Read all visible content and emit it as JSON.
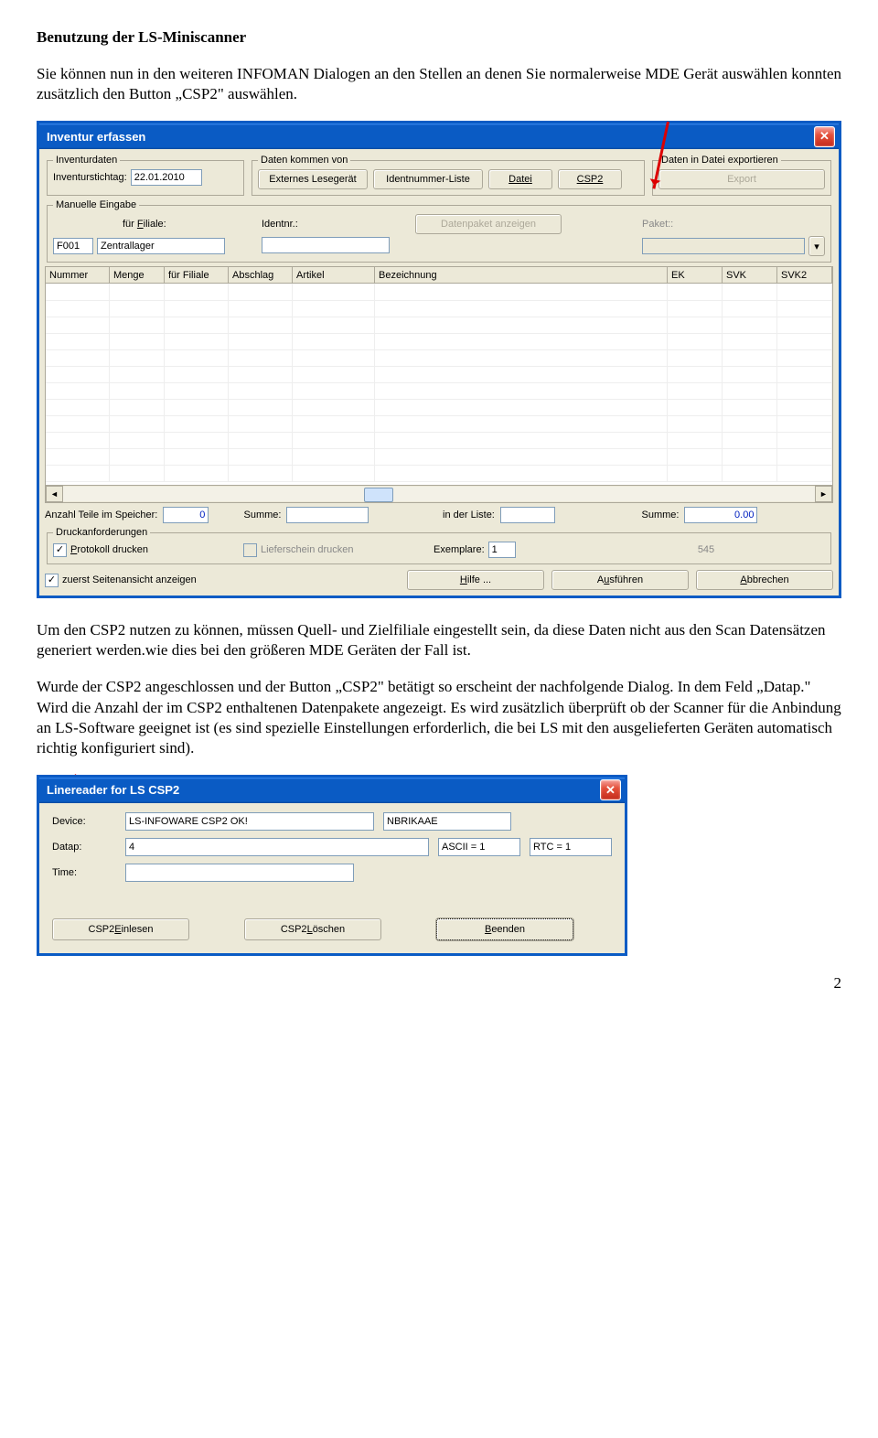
{
  "doc": {
    "heading": "Benutzung der LS-Miniscanner",
    "p1": "Sie können nun in den weiteren INFOMAN Dialogen an den Stellen an denen Sie normalerweise MDE Gerät auswählen konnten zusätzlich den Button „CSP2\" auswählen.",
    "p2": "Um den CSP2 nutzen zu können, müssen Quell- und Zielfiliale eingestellt sein, da diese Daten nicht aus den Scan Datensätzen generiert werden.wie dies bei den größeren MDE Geräten der Fall ist.",
    "p3": "Wurde der CSP2 angeschlossen und der Button „CSP2\" betätigt so erscheint der nachfolgende Dialog. In dem Feld „Datap.\" Wird die Anzahl der im CSP2 enthaltenen Datenpakete angezeigt. Es wird zusätzlich überprüft ob der Scanner für die Anbindung an LS-Software geeignet ist (es sind spezielle Einstellungen erforderlich, die bei LS mit den ausgelieferten Geräten automatisch richtig konfiguriert sind).",
    "pagenum": "2"
  },
  "win1": {
    "title": "Inventur erfassen",
    "groups": {
      "inv": "Inventurdaten",
      "daten": "Daten kommen von",
      "export": "Daten in Datei exportieren",
      "manuelle": "Manuelle Eingabe",
      "druck": "Druckanforderungen"
    },
    "labels": {
      "stichtag": "Inventurstichtag:",
      "filiale_u": "für Filiale:",
      "identnr": "Identnr.:",
      "anzahl": "Anzahl Teile im Speicher:",
      "summe": "Summe:",
      "inliste": "in der Liste:",
      "exemplare": "Exemplare:",
      "paket": "Paket::"
    },
    "values": {
      "stichtag": "22.01.2010",
      "f001": "F001",
      "zentrallager": "Zentrallager",
      "anzahl": "0",
      "summe1": "",
      "inliste": "",
      "summe2": "0.00",
      "exemplare": "1",
      "num545": "545"
    },
    "buttons": {
      "externes": "Externes Lesegerät",
      "identliste": "Identnummer-Liste",
      "datei": "Datei",
      "csp2": "CSP2",
      "export": "Export",
      "datenpaket": "Datenpaket anzeigen",
      "hilfe": "Hilfe ...",
      "ausfuehren": "Ausführen",
      "abbrechen": "Abbrechen"
    },
    "checks": {
      "protokoll": "Protokoll drucken",
      "liefer": "Lieferschein drucken",
      "seiten": "zuerst Seitenansicht anzeigen"
    },
    "cols": [
      "Nummer",
      "Menge",
      "für Filiale",
      "Abschlag",
      "Artikel",
      "Bezeichnung",
      "EK",
      "SVK",
      "SVK2"
    ]
  },
  "win2": {
    "title": "Linereader for LS CSP2",
    "labels": {
      "device": "Device:",
      "datap": "Datap:",
      "time": "Time:"
    },
    "values": {
      "device": "LS-INFOWARE CSP2 OK!",
      "user": "NBRIKAAE",
      "datap": "4",
      "ascii": "ASCII = 1",
      "rtc": "RTC = 1",
      "time": ""
    },
    "buttons": {
      "einlesen": "CSP2 Einlesen",
      "loeschen": "CSP2 Löschen",
      "beenden": "Beenden"
    }
  }
}
